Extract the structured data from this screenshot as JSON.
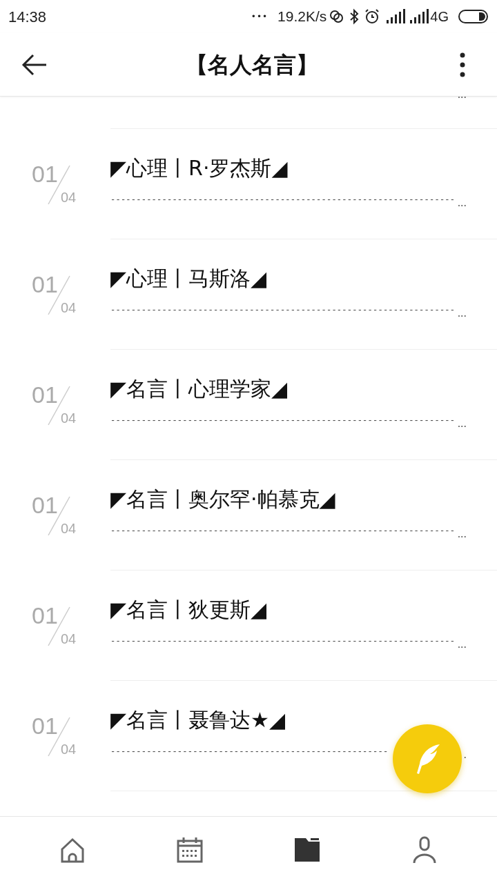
{
  "status_bar": {
    "time": "14:38",
    "dots": "•••",
    "speed": "19.2K/s",
    "network": "4G"
  },
  "header": {
    "title": "【名人名言】"
  },
  "partial_item": {
    "preview_tail": "..."
  },
  "items": [
    {
      "num": "01",
      "total": "04",
      "title": "◤心理丨R·罗杰斯◢",
      "preview": "-------------------------------------------------------------------",
      "preview_tail": "..."
    },
    {
      "num": "01",
      "total": "04",
      "title": "◤心理丨马斯洛◢",
      "preview": "-------------------------------------------------------------------",
      "preview_tail": "..."
    },
    {
      "num": "01",
      "total": "04",
      "title": "◤名言丨心理学家◢",
      "preview": "-------------------------------------------------------------------",
      "preview_tail": "..."
    },
    {
      "num": "01",
      "total": "04",
      "title": "◤名言丨奥尔罕·帕慕克◢",
      "preview": "-------------------------------------------------------------------",
      "preview_tail": "..."
    },
    {
      "num": "01",
      "total": "04",
      "title": "◤名言丨狄更斯◢",
      "preview": "-------------------------------------------------------------------",
      "preview_tail": "..."
    },
    {
      "num": "01",
      "total": "04",
      "title": "◤名言丨聂鲁达★◢",
      "preview": "------------------------------------------------------",
      "preview_tail": "."
    }
  ],
  "bottom_nav": [
    {
      "kind": "home",
      "selected": false
    },
    {
      "kind": "calendar",
      "selected": false
    },
    {
      "kind": "folder",
      "selected": true
    },
    {
      "kind": "profile",
      "selected": false
    }
  ]
}
